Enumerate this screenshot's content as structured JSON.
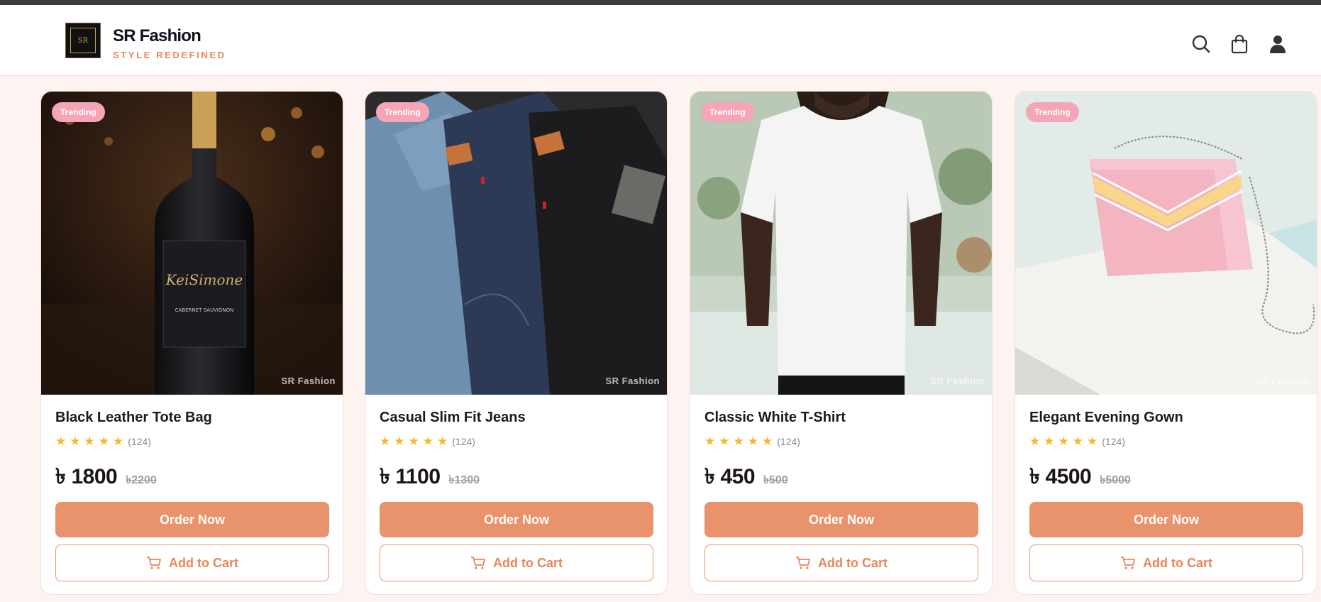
{
  "brand": {
    "name": "SR Fashion",
    "tagline": "STYLE REDEFINED",
    "logo_text": "SR"
  },
  "header_icons": [
    "search-icon",
    "shopping-bag-icon",
    "user-icon"
  ],
  "colors": {
    "accent": "#e8936b",
    "badge": "#f4a6b7",
    "star": "#f5b92d",
    "text": "#221624"
  },
  "products": [
    {
      "badge": "Trending",
      "title": "Black Leather Tote Bag",
      "rating": 5,
      "reviews": "(124)",
      "currency": "৳",
      "price": "1800",
      "old_price": "2200",
      "watermark": "SR Fashion",
      "order_label": "Order Now",
      "cart_label": "Add to Cart"
    },
    {
      "badge": "Trending",
      "title": "Casual Slim Fit Jeans",
      "rating": 5,
      "reviews": "(124)",
      "currency": "৳",
      "price": "1100",
      "old_price": "1300",
      "watermark": "SR Fashion",
      "order_label": "Order Now",
      "cart_label": "Add to Cart"
    },
    {
      "badge": "Trending",
      "title": "Classic White T-Shirt",
      "rating": 5,
      "reviews": "(124)",
      "currency": "৳",
      "price": "450",
      "old_price": "500",
      "watermark": "SR Fashion",
      "order_label": "Order Now",
      "cart_label": "Add to Cart"
    },
    {
      "badge": "Trending",
      "title": "Elegant Evening Gown",
      "rating": 5,
      "reviews": "(124)",
      "currency": "৳",
      "price": "4500",
      "old_price": "5000",
      "watermark": "SR Fashion",
      "order_label": "Order Now",
      "cart_label": "Add to Cart"
    }
  ]
}
